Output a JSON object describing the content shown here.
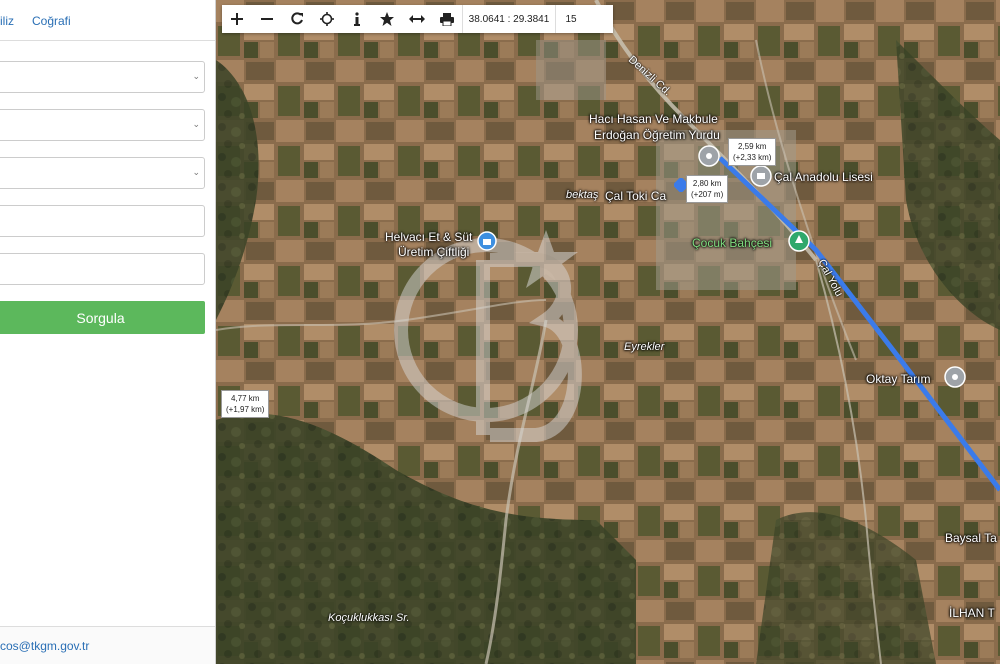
{
  "left_panel": {
    "tabs": [
      "iliz",
      "Coğrafi"
    ],
    "query_button": "Sorgula",
    "footer_email": "cos@tkgm.gov.tr"
  },
  "toolbar": {
    "icons": [
      "zoom-in-icon",
      "zoom-out-icon",
      "refresh-icon",
      "locate-icon",
      "info-icon",
      "favorite-star-icon",
      "measure-icon",
      "print-icon"
    ],
    "coordinates": "38.0641 : 29.3841",
    "zoom": "15"
  },
  "map": {
    "place_labels": {
      "yurt_1": "Hacı Hasan Ve Makbule",
      "yurt_2": "Erdoğan Öğretim Yurdu",
      "lise": "Çal Anadolu Lisesi",
      "toki": "Çal Toki Ca",
      "bektas": "bektaş",
      "helvaci_1": "Helvacı Et & Süt",
      "helvaci_2": "Üretim Çiftliği",
      "cocuk": "Çocuk Bahçesi",
      "eyrekler": "Eyrekler",
      "oktay": "Oktay Tarım",
      "baysal": "Baysal Ta",
      "ilhan": "İLHAN T",
      "kocuk": "Koçuklukkası Sr."
    },
    "road_labels": {
      "denizli": "Denizli Cd.",
      "cal_yolu": "Çal Yolu"
    },
    "measure_boxes": [
      {
        "line1": "2,59 km",
        "line2": "(+2,33 km)"
      },
      {
        "line1": "2,80 km",
        "line2": "(+207 m)"
      },
      {
        "line1": "4,77 km",
        "line2": "(+1,97 km)"
      }
    ],
    "watermark": "CB"
  },
  "colors": {
    "accent_green": "#5cb85c",
    "link_blue": "#2a6fb5",
    "route_blue": "#3b7bea"
  }
}
